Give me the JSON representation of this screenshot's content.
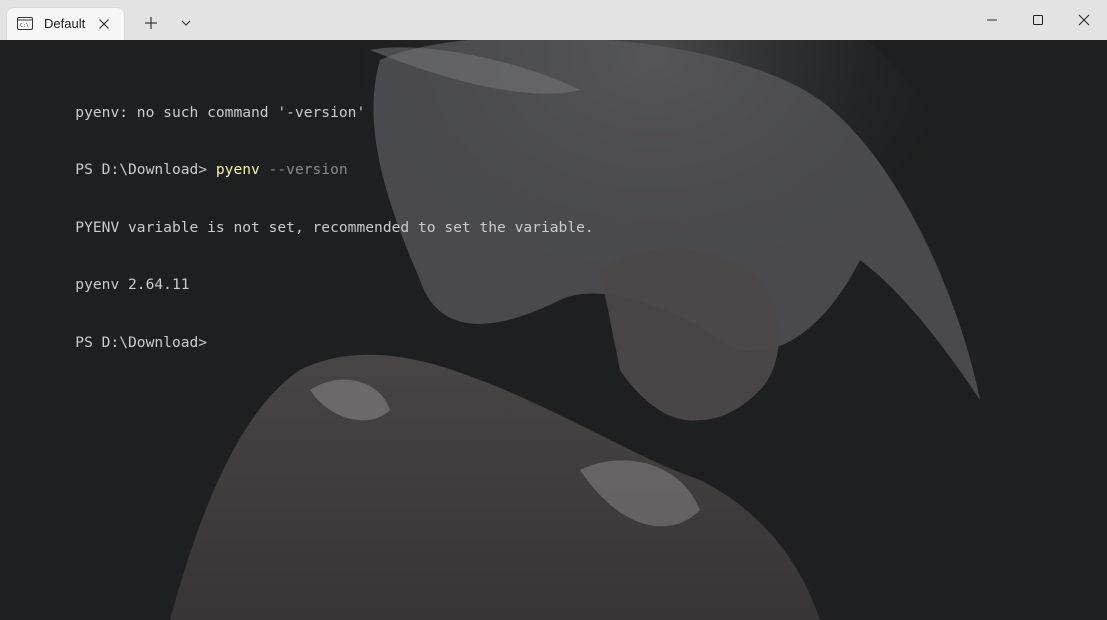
{
  "window": {
    "tab_title": "Default",
    "tab_icon": "terminal-icon",
    "controls": [
      "minimize-icon",
      "maximize-icon",
      "close-icon"
    ],
    "new_tab_icon": "plus-icon",
    "dropdown_icon": "chevron-down-icon"
  },
  "terminal": {
    "lines": [
      {
        "text": "pyenv: no such command '-version'"
      },
      {
        "prompt": "PS D:\\Download> ",
        "command": "pyenv",
        "argument": " --version"
      },
      {
        "text": "PYENV variable is not set, recommended to set the variable."
      },
      {
        "text": "pyenv 2.64.11"
      },
      {
        "prompt": "PS D:\\Download>"
      }
    ]
  },
  "colors": {
    "titlebar": "#e3e3e3",
    "tab": "#f7f7f7",
    "terminal_bg": "#1c1e1f",
    "text": "#cccccc",
    "command": "#f9f1a5",
    "parameter": "#8a8a8a"
  }
}
